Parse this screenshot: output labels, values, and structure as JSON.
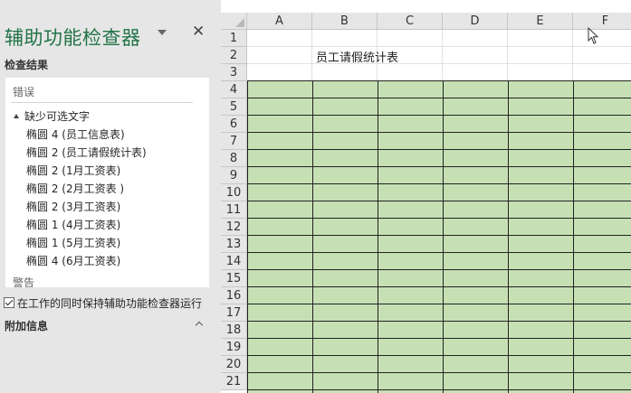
{
  "pane": {
    "title": "辅助功能检查器",
    "results_title": "检查结果",
    "errors_header": "错误",
    "group_label": "缺少可选文字",
    "items": [
      "椭圆 4 (员工信息表)",
      "椭圆 2 (员工请假统计表)",
      "椭圆 2 (1月工资表)",
      "椭圆 2 (2月工资表 )",
      "椭圆 2 (3月工资表)",
      "椭圆 1 (4月工资表)",
      "椭圆 1 (5月工资表)",
      "椭圆 4 (6月工资表)"
    ],
    "warnings_header": "警告",
    "checkbox_label": "在工作的同时保持辅助功能检查器运行",
    "checkbox_checked": true,
    "extra_title": "附加信息"
  },
  "sheet": {
    "columns": [
      "A",
      "B",
      "C",
      "D",
      "E",
      "F"
    ],
    "rows": [
      "1",
      "2",
      "3",
      "4",
      "5",
      "6",
      "7",
      "8",
      "9",
      "10",
      "11",
      "12",
      "13",
      "14",
      "15",
      "16",
      "17",
      "18",
      "19",
      "20",
      "21"
    ],
    "table_title": "员工请假统计表",
    "fill_color": "#c6e0b4",
    "accent_color": "#217346"
  }
}
